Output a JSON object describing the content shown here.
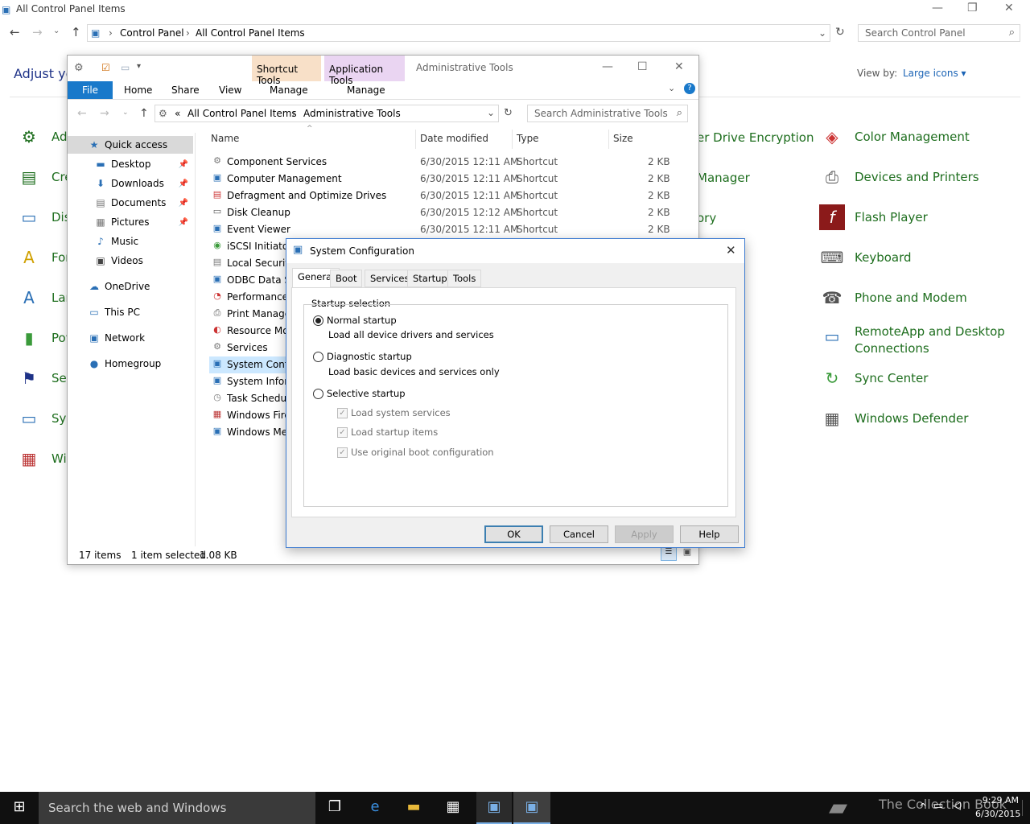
{
  "control_panel": {
    "window_title": "All Control Panel Items",
    "breadcrumb": [
      "Control Panel",
      "All Control Panel Items"
    ],
    "search_placeholder": "Search Control Panel",
    "heading": "Adjust yo",
    "view_by_label": "View by:",
    "view_by_value": "Large icons",
    "left_items": [
      "Ad",
      "Cre",
      "Dis",
      "For",
      "Lar",
      "Pov",
      "Sec",
      "Sys",
      "Wir"
    ],
    "mid_items": [
      "er Drive Encryption",
      "Manager",
      "ory"
    ],
    "right_items": [
      "Color Management",
      "Devices and Printers",
      "Flash Player",
      "Keyboard",
      "Phone and Modem",
      "RemoteApp and Desktop",
      "Connections",
      "Sync Center",
      "Windows Defender"
    ]
  },
  "explorer": {
    "shortcut_tools": "Shortcut Tools",
    "application_tools": "Application Tools",
    "title": "Administrative Tools",
    "ribbon_tabs": [
      "File",
      "Home",
      "Share",
      "View",
      "Manage",
      "Manage"
    ],
    "address_prefix": "«",
    "breadcrumb": [
      "All Control Panel Items",
      "Administrative Tools"
    ],
    "search_placeholder": "Search Administrative Tools",
    "nav": [
      "Quick access",
      "Desktop",
      "Downloads",
      "Documents",
      "Pictures",
      "Music",
      "Videos",
      "OneDrive",
      "This PC",
      "Network",
      "Homegroup"
    ],
    "columns": [
      "Name",
      "Date modified",
      "Type",
      "Size"
    ],
    "files": [
      {
        "name": "Component Services",
        "date": "6/30/2015 12:11 AM",
        "type": "Shortcut",
        "size": "2 KB"
      },
      {
        "name": "Computer Management",
        "date": "6/30/2015 12:11 AM",
        "type": "Shortcut",
        "size": "2 KB"
      },
      {
        "name": "Defragment and Optimize Drives",
        "date": "6/30/2015 12:11 AM",
        "type": "Shortcut",
        "size": "2 KB"
      },
      {
        "name": "Disk Cleanup",
        "date": "6/30/2015 12:12 AM",
        "type": "Shortcut",
        "size": "2 KB"
      },
      {
        "name": "Event Viewer",
        "date": "6/30/2015 12:11 AM",
        "type": "Shortcut",
        "size": "2 KB"
      },
      {
        "name": "iSCSI Initiator",
        "date": "",
        "type": "",
        "size": ""
      },
      {
        "name": "Local Security",
        "date": "",
        "type": "",
        "size": ""
      },
      {
        "name": "ODBC Data So",
        "date": "",
        "type": "",
        "size": ""
      },
      {
        "name": "Performance M",
        "date": "",
        "type": "",
        "size": ""
      },
      {
        "name": "Print Manager",
        "date": "",
        "type": "",
        "size": ""
      },
      {
        "name": "Resource Mor",
        "date": "",
        "type": "",
        "size": ""
      },
      {
        "name": "Services",
        "date": "",
        "type": "",
        "size": ""
      },
      {
        "name": "System Config",
        "date": "",
        "type": "",
        "size": ""
      },
      {
        "name": "System Inform",
        "date": "",
        "type": "",
        "size": ""
      },
      {
        "name": "Task Schedule",
        "date": "",
        "type": "",
        "size": ""
      },
      {
        "name": "Windows Firev",
        "date": "",
        "type": "",
        "size": ""
      },
      {
        "name": "Windows Mer",
        "date": "",
        "type": "",
        "size": ""
      }
    ],
    "status_count": "17 items",
    "status_selected": "1 item selected",
    "status_size": "1.08 KB"
  },
  "sysconfig": {
    "title": "System Configuration",
    "tabs": [
      "General",
      "Boot",
      "Services",
      "Startup",
      "Tools"
    ],
    "group_label": "Startup selection",
    "normal": "Normal startup",
    "normal_desc": "Load all device drivers and services",
    "diagnostic": "Diagnostic startup",
    "diagnostic_desc": "Load basic devices and services only",
    "selective": "Selective startup",
    "chk_services": "Load system services",
    "chk_startup": "Load startup items",
    "chk_boot": "Use original boot configuration",
    "ok": "OK",
    "cancel": "Cancel",
    "apply": "Apply",
    "help": "Help"
  },
  "taskbar": {
    "search": "Search the web and Windows",
    "time": "9:29 AM",
    "date": "6/30/2015",
    "watermark": "The Collection Book"
  }
}
